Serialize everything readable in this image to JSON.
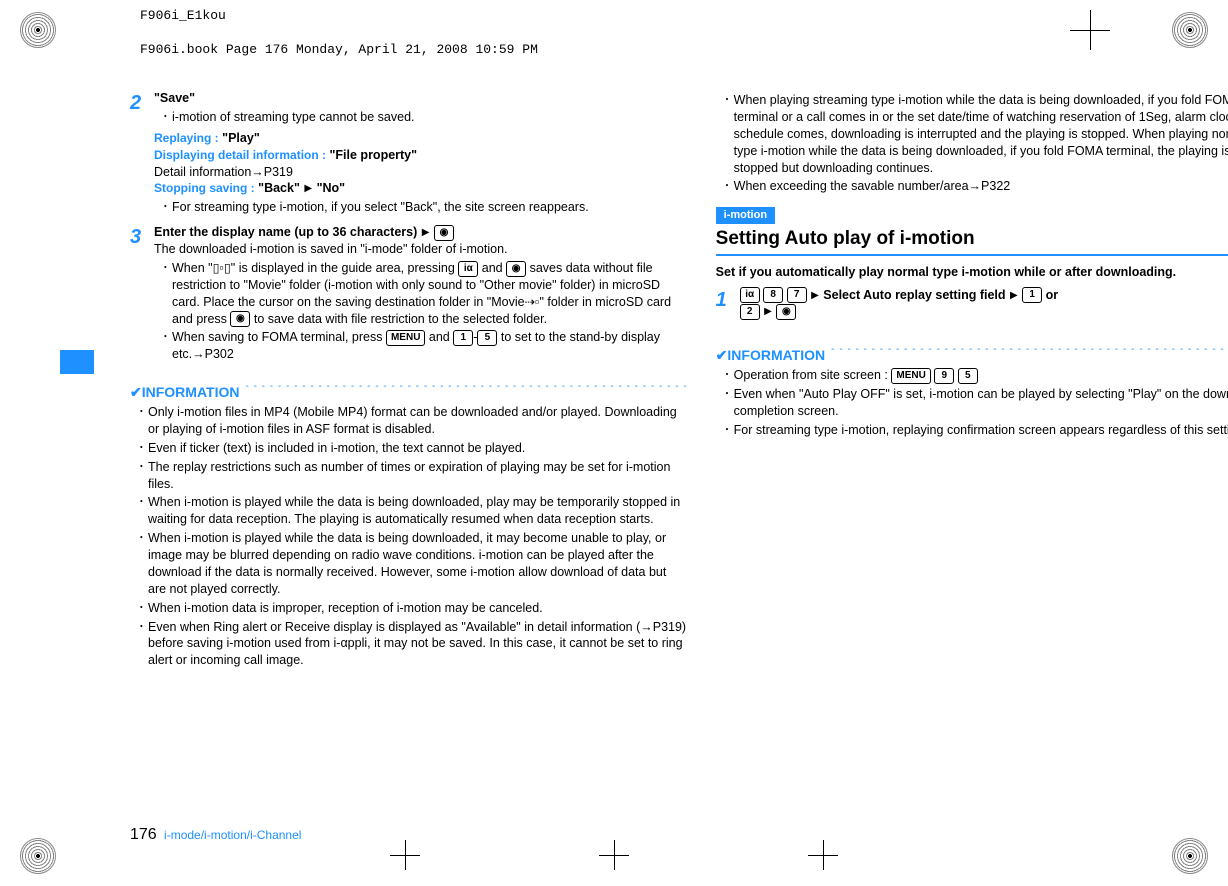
{
  "meta": {
    "filename": "F906i_E1kou",
    "bookline": "F906i.book  Page 176  Monday, April 21, 2008  10:59 PM"
  },
  "left": {
    "step2_num": "2",
    "step2_title": "\"Save\"",
    "step2_bullet": "i-motion of streaming type cannot be saved.",
    "replaying_label": "Replaying :",
    "replaying_val": "\"Play\"",
    "detail_label": "Displaying detail information :",
    "detail_val": "\"File property\"",
    "detail_info": "Detail information→P319",
    "stop_label": "Stopping saving :",
    "stop_val": "\"Back\"",
    "stop_arrow_val": "\"No\"",
    "stop_note": "For streaming type i-motion, if you select \"Back\", the site screen reappears.",
    "step3_num": "3",
    "step3_title_a": "Enter the display name (up to 36 characters)",
    "step3_key": "◉",
    "step3_line1": "The downloaded i-motion is saved in \"i-mode\" folder of i-motion.",
    "step3_b1_a": "When \"",
    "step3_b1_b": "\" is displayed in the guide area, pressing ",
    "step3_b1_c": " and ",
    "step3_b1_d": " saves data without file restriction to \"Movie\" folder (i-motion with only sound to \"Other movie\" folder) in microSD card. Place the cursor on the saving destination folder in \"Movie",
    "step3_b1_e": "\" folder in microSD card and press ",
    "step3_b1_f": " to save data with file restriction to the selected folder.",
    "step3_b2_a": "When saving to FOMA terminal, press ",
    "step3_b2_b": " and ",
    "step3_b2_c": "-",
    "step3_b2_d": " to set to the stand-by display etc.→P302",
    "info_label": "✔INFORMATION",
    "info_items": [
      "Only i-motion files in MP4 (Mobile MP4) format can be downloaded and/or played. Downloading or playing of i-motion files in ASF format is disabled.",
      "Even if ticker (text) is included in i-motion, the text cannot be played.",
      "The replay restrictions such as number of times or expiration of playing may be set for i-motion files.",
      "When i-motion is played while the data is being downloaded, play may be temporarily stopped in waiting for data reception. The playing is automatically resumed when data reception starts.",
      "When i-motion is played while the data is being downloaded, it may become unable to play, or image may be blurred depending on radio wave conditions. i-motion can be played after the download if the data is normally received. However, some i-motion allow download of data but are not played correctly.",
      "When i-motion data is improper, reception of i-motion may be canceled.",
      "Even when Ring alert or Receive display is displayed as \"Available\" in detail information (→P319) before saving i-motion used from i-αppli, it may not be saved. In this case, it cannot be set to ring alert or incoming call image."
    ]
  },
  "right": {
    "top_items": [
      "When playing streaming type i-motion while the data is being downloaded, if you fold FOMA terminal or a call comes in or the set date/time of watching reservation of 1Seg, alarm clock or schedule comes, downloading is interrupted and the playing is stopped. When playing normal type i-motion while the data is being downloaded, if you fold FOMA terminal, the playing is stopped but downloading continues.",
      "When exceeding the savable number/area→P322"
    ],
    "tag": "i-motion",
    "title": "Setting Auto play of i-motion",
    "lead": "Set if you automatically play normal type i-motion while or after downloading.",
    "step1_num": "1",
    "step1_keys": [
      "iα",
      "8",
      "7"
    ],
    "step1_mid": "Select Auto replay setting field",
    "step1_keys2": [
      "1"
    ],
    "step1_or": " or ",
    "step1_keys3": [
      "2"
    ],
    "step1_end_key": "◉",
    "info_label": "✔INFORMATION",
    "info_op_a": "Operation from site screen : ",
    "info_op_keys": [
      "MENU",
      "9",
      "5"
    ],
    "info_items": [
      "Even when \"Auto Play OFF\" is set, i-motion can be played by selecting \"Play\" on the download completion screen.",
      "For streaming type i-motion, replaying confirmation screen appears regardless of this setting."
    ]
  },
  "footer": {
    "page": "176",
    "section": "i-mode/i-motion/i-Channel"
  }
}
